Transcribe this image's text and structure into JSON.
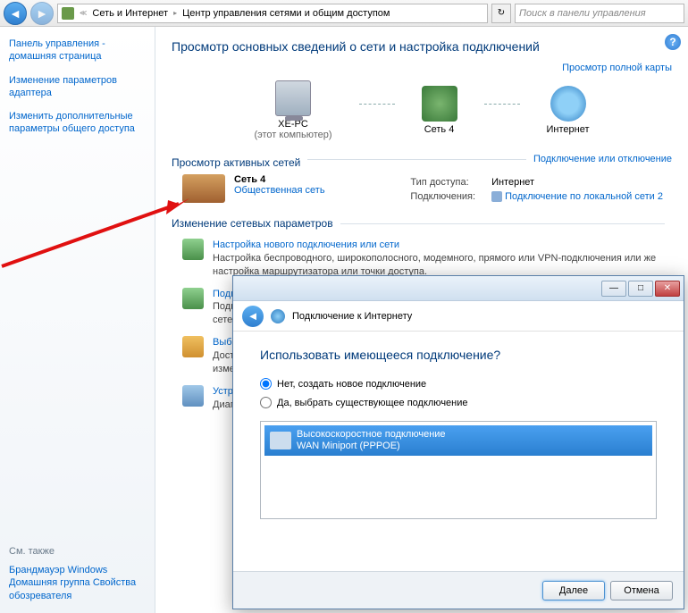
{
  "nav": {
    "crumb1": "Сеть и Интернет",
    "crumb2": "Центр управления сетями и общим доступом",
    "search_placeholder": "Поиск в панели управления"
  },
  "sidebar": {
    "links": [
      "Панель управления - домашняя страница",
      "Изменение параметров адаптера",
      "Изменить дополнительные параметры общего доступа"
    ],
    "see_also_hd": "См. также",
    "see_also": [
      "Брандмауэр Windows",
      "Домашняя группа",
      "Свойства обозревателя"
    ]
  },
  "main": {
    "title": "Просмотр основных сведений о сети и настройка подключений",
    "full_map": "Просмотр полной карты",
    "nodes": {
      "pc": "XE-PC",
      "pc_sub": "(этот компьютер)",
      "net": "Сеть 4",
      "inet": "Интернет"
    },
    "active_hd": "Просмотр активных сетей",
    "connect_disconnect": "Подключение или отключение",
    "network_name": "Сеть 4",
    "network_type": "Общественная сеть",
    "access_lbl": "Тип доступа:",
    "access_val": "Интернет",
    "conn_lbl": "Подключения:",
    "conn_val": "Подключение по локальной сети 2",
    "params_hd": "Изменение сетевых параметров",
    "action1_title": "Настройка нового подключения или сети",
    "action1_desc": "Настройка беспроводного, широкополосного, модемного, прямого или VPN-подключения или же настройка маршрутизатора или точки доступа.",
    "action2_title": "Подключиться к сети",
    "action2_desc": "Подк",
    "action2_desc2": "сете",
    "action3_title": "Выб",
    "action3_desc": "Дост",
    "action3_desc2": "изме",
    "action4_title": "Устр",
    "action4_desc": "Диаг"
  },
  "dialog": {
    "title": "Подключение к Интернету",
    "question": "Использовать имеющееся подключение?",
    "opt_no": "Нет, создать новое подключение",
    "opt_yes": "Да, выбрать существующее подключение",
    "item_line1": "Высокоскоростное подключение",
    "item_line2": "WAN Miniport (PPPOE)",
    "next": "Далее",
    "cancel": "Отмена"
  }
}
